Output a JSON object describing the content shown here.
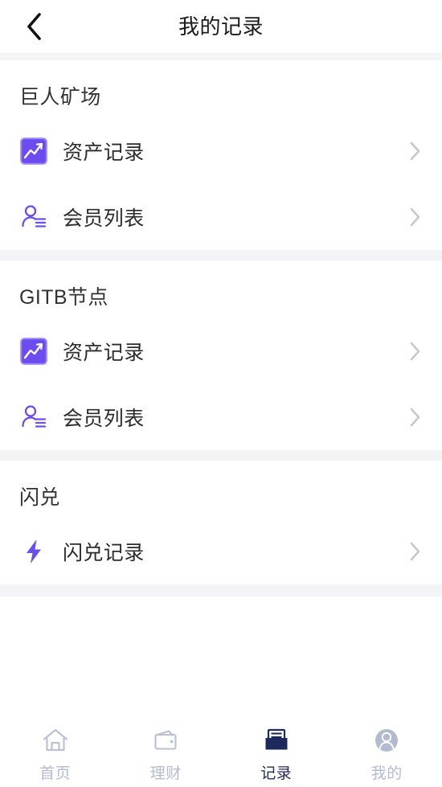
{
  "header": {
    "title": "我的记录",
    "back_icon": "chevron-left-icon"
  },
  "colors": {
    "accent_purple": "#6C4CF1",
    "icon_purple": "#6B4EF0",
    "tab_active": "#1C2A5E",
    "tab_inactive": "#B3BBD1",
    "divider_gray": "#F4F4F6",
    "chevron_gray": "#C8C8C8",
    "title_text": "#323232",
    "row_text": "#2B2B2B"
  },
  "sections": [
    {
      "title": "巨人矿场",
      "rows": [
        {
          "label": "资产记录",
          "icon": "chart-trend-icon",
          "chevron": "chevron-right-icon"
        },
        {
          "label": "会员列表",
          "icon": "member-list-icon",
          "chevron": "chevron-right-icon"
        }
      ]
    },
    {
      "title": "GITB节点",
      "rows": [
        {
          "label": "资产记录",
          "icon": "chart-trend-icon",
          "chevron": "chevron-right-icon"
        },
        {
          "label": "会员列表",
          "icon": "member-list-icon",
          "chevron": "chevron-right-icon"
        }
      ]
    },
    {
      "title": "闪兑",
      "rows": [
        {
          "label": "闪兑记录",
          "icon": "lightning-bolt-icon",
          "chevron": "chevron-right-icon"
        }
      ]
    }
  ],
  "tabbar": {
    "items": [
      {
        "label": "首页",
        "icon": "home-icon",
        "active": false
      },
      {
        "label": "理财",
        "icon": "wallet-icon",
        "active": false
      },
      {
        "label": "记录",
        "icon": "records-tray-icon",
        "active": true
      },
      {
        "label": "我的",
        "icon": "profile-avatar-icon",
        "active": false
      }
    ]
  }
}
